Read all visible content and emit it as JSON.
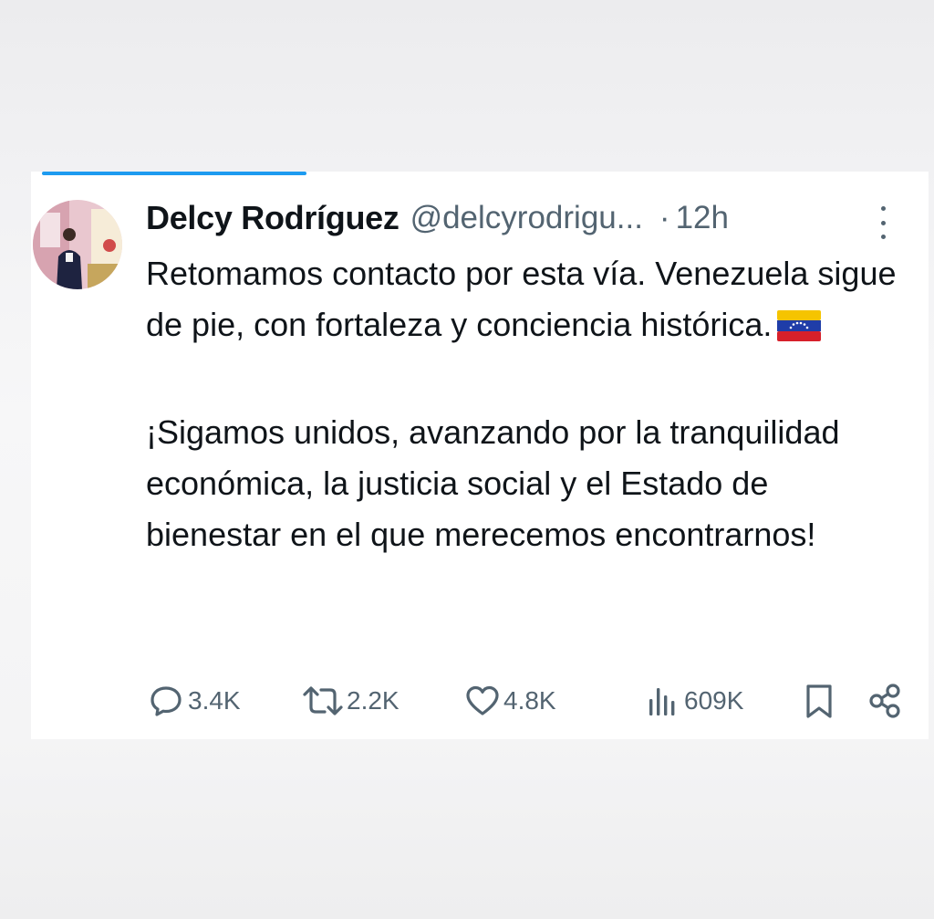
{
  "tweet": {
    "author_name": "Delcy Rodríguez",
    "handle": "@delcyrodrigu...",
    "separator": "·",
    "time": "12h",
    "text_paragraph_1": "Retomamos contacto por esta vía. Venezuela sigue de pie, con fortaleza y conciencia histórica.",
    "flag_emoji": "venezuela-flag-emoji",
    "text_paragraph_2": "¡Sigamos unidos, avanzando por la tranquilidad económica, la justicia social y el Estado de bienestar en el que merecemos encontrarnos!"
  },
  "actions": {
    "replies": "3.4K",
    "reposts": "2.2K",
    "likes": "4.8K",
    "views": "609K",
    "bookmark_icon": "bookmark-icon",
    "share_icon": "share-icon"
  },
  "colors": {
    "accent": "#1d9bf0",
    "text_primary": "#0f1419",
    "text_secondary": "#536471"
  }
}
